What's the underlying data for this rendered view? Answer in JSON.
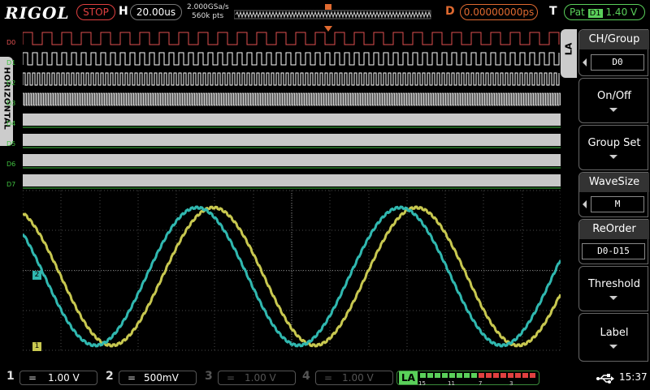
{
  "brand": "RIGOL",
  "run_state": "STOP",
  "horizontal": {
    "label": "H",
    "timebase": "20.00us",
    "sample_rate": "2.000GSa/s",
    "memory_depth": "560k pts"
  },
  "trigger_delay": {
    "label": "D",
    "value": "0.00000000ps"
  },
  "trigger": {
    "label": "T",
    "mode": "Pat",
    "source": "D1",
    "level": "1.40 V"
  },
  "side_tab": "HORIZONTAL",
  "la_tab": "LA",
  "digital_channels": [
    "D0",
    "D1",
    "D2",
    "D3",
    "D4",
    "D5",
    "D6",
    "D7"
  ],
  "analog_markers": [
    "2",
    "1"
  ],
  "menu": {
    "ch_group": {
      "title": "CH/Group",
      "value": "D0"
    },
    "on_off": {
      "title": "On/Off"
    },
    "group_set": {
      "title": "Group Set"
    },
    "wave_size": {
      "title": "WaveSize",
      "value": "M"
    },
    "reorder": {
      "title": "ReOrder",
      "value": "D0-D15"
    },
    "threshold": {
      "title": "Threshold"
    },
    "label": {
      "title": "Label"
    }
  },
  "bottom": {
    "channels": [
      {
        "num": "1",
        "coupling": "=",
        "scale": "1.00 V",
        "color": "#e5e53a",
        "active": true
      },
      {
        "num": "2",
        "coupling": "=",
        "scale": "500mV",
        "color": "#3ec7c7",
        "active": true
      },
      {
        "num": "3",
        "coupling": "=",
        "scale": "1.00 V",
        "color": "#555555",
        "active": false
      },
      {
        "num": "4",
        "coupling": "=",
        "scale": "1.00 V",
        "color": "#555555",
        "active": false
      }
    ],
    "la": {
      "label": "LA",
      "ticks": [
        "15",
        "11",
        "7",
        "3"
      ]
    },
    "usb_icon": "usb-icon",
    "time": "15:37"
  },
  "colors": {
    "ch1": "#c8c850",
    "ch2": "#30b8b0",
    "d0": "#e05050",
    "digital_label": "#40c040",
    "grid": "#4a4a4a"
  }
}
